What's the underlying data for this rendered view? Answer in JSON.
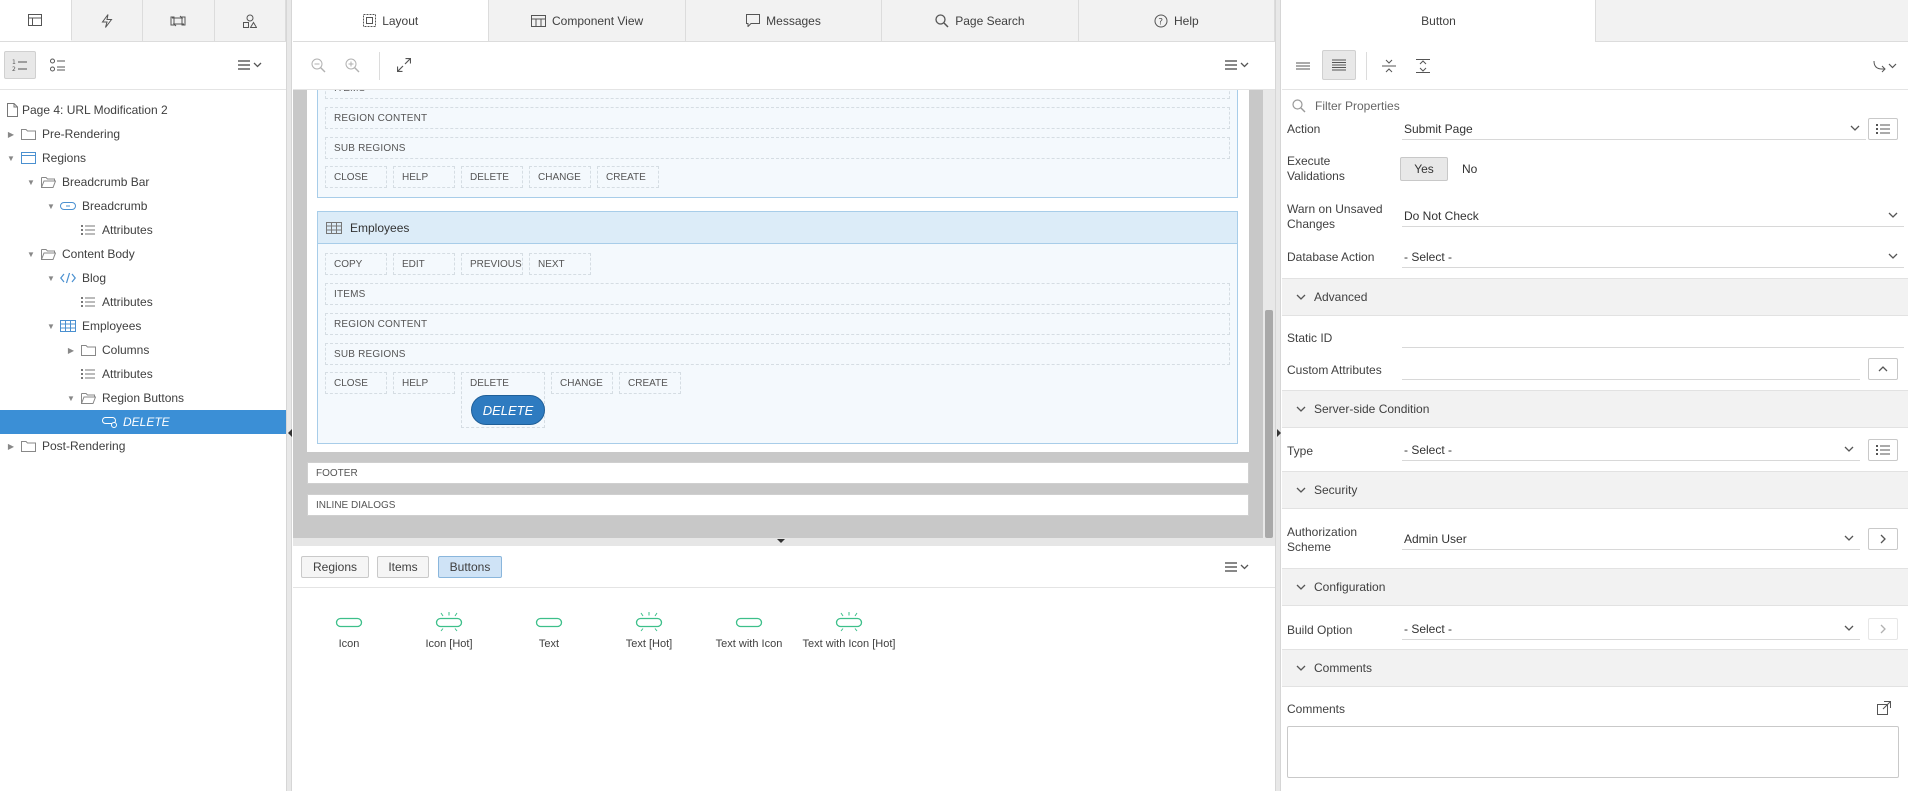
{
  "left": {
    "tree": {
      "root": "Page 4: URL Modification 2",
      "pre_rendering": "Pre-Rendering",
      "regions": "Regions",
      "breadcrumb_bar": "Breadcrumb Bar",
      "breadcrumb": "Breadcrumb",
      "attributes1": "Attributes",
      "content_body": "Content Body",
      "blog": "Blog",
      "attributes2": "Attributes",
      "employees": "Employees",
      "columns": "Columns",
      "attributes3": "Attributes",
      "region_buttons": "Region Buttons",
      "delete": "DELETE",
      "post_rendering": "Post-Rendering"
    }
  },
  "center": {
    "tabs": {
      "layout": "Layout",
      "component_view": "Component View",
      "messages": "Messages",
      "page_search": "Page Search",
      "help": "Help"
    },
    "layout": {
      "top_region": {
        "items": "ITEMS",
        "region_content": "REGION CONTENT",
        "sub_regions": "SUB REGIONS",
        "buttons": [
          "CLOSE",
          "HELP",
          "DELETE",
          "CHANGE",
          "CREATE"
        ]
      },
      "employees": {
        "title": "Employees",
        "top_buttons": [
          "COPY",
          "EDIT",
          "PREVIOUS",
          "NEXT"
        ],
        "items": "ITEMS",
        "region_content": "REGION CONTENT",
        "sub_regions": "SUB REGIONS",
        "bottom_buttons": [
          "CLOSE",
          "HELP",
          "DELETE",
          "CHANGE",
          "CREATE"
        ],
        "delete_button": "DELETE"
      },
      "footer": "FOOTER",
      "inline_dialogs": "INLINE DIALOGS"
    },
    "gallery": {
      "tabs": {
        "regions": "Regions",
        "items": "Items",
        "buttons": "Buttons"
      },
      "items": [
        "Icon",
        "Icon [Hot]",
        "Text",
        "Text [Hot]",
        "Text with Icon",
        "Text with Icon [Hot]"
      ]
    }
  },
  "right": {
    "tab": "Button",
    "filter_placeholder": "Filter Properties",
    "action": {
      "label": "Action",
      "value": "Submit Page"
    },
    "execute_validations": {
      "label": "Execute Validations",
      "yes": "Yes",
      "no": "No"
    },
    "warn_unsaved": {
      "label": "Warn on Unsaved Changes",
      "value": "Do Not Check"
    },
    "database_action": {
      "label": "Database Action",
      "value": "- Select -"
    },
    "sections": {
      "advanced": "Advanced",
      "server_side": "Server-side Condition",
      "security": "Security",
      "configuration": "Configuration",
      "comments": "Comments"
    },
    "static_id": {
      "label": "Static ID"
    },
    "custom_attributes": {
      "label": "Custom Attributes"
    },
    "type": {
      "label": "Type",
      "value": "- Select -"
    },
    "authorization": {
      "label": "Authorization Scheme",
      "value": "Admin User"
    },
    "build_option": {
      "label": "Build Option",
      "value": "- Select -"
    },
    "comments": {
      "label": "Comments"
    }
  },
  "colors": {
    "selection": "#3b8fd6",
    "region_border": "#a8cde9",
    "region_header": "#dcecf8",
    "hot_button": "#2e7bc0",
    "gallery_icon": "#3dbf8a"
  }
}
